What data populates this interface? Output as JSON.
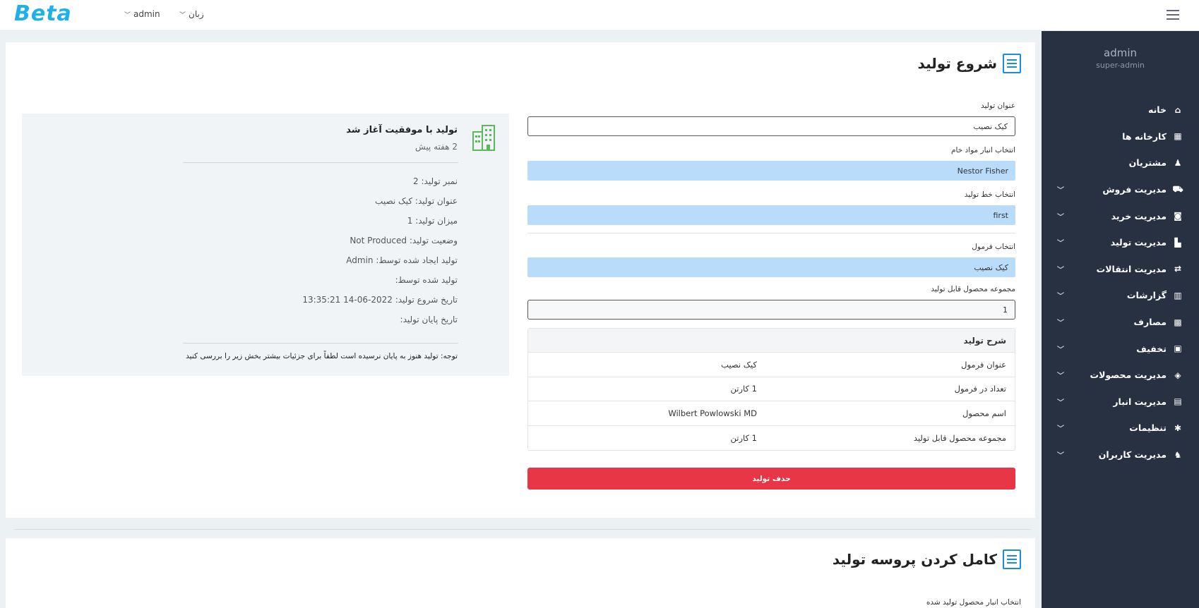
{
  "topbar": {
    "logo": "Beta",
    "user_menu": "admin",
    "language_menu": "زبان"
  },
  "sidebar": {
    "user_name": "admin",
    "user_role": "super-admin",
    "items": [
      {
        "label": "خانه",
        "icon": "home-icon",
        "glyph": "⌂",
        "submenu": false
      },
      {
        "label": "کارخانه ها",
        "icon": "factory-icon",
        "glyph": "▦",
        "submenu": false
      },
      {
        "label": "مشتریان",
        "icon": "users-icon",
        "glyph": "♟",
        "submenu": false
      },
      {
        "label": "مدیریت فروش",
        "icon": "cart-icon",
        "glyph": "⛟",
        "submenu": true
      },
      {
        "label": "مدیریت خرید",
        "icon": "bag-icon",
        "glyph": "◙",
        "submenu": true
      },
      {
        "label": "مدیریت تولید",
        "icon": "production-icon",
        "glyph": "▙",
        "submenu": true
      },
      {
        "label": "مدیریت انتقالات",
        "icon": "transfer-icon",
        "glyph": "⇄",
        "submenu": true
      },
      {
        "label": "گزارشات",
        "icon": "report-icon",
        "glyph": "▥",
        "submenu": true
      },
      {
        "label": "مصارف",
        "icon": "expense-icon",
        "glyph": "▩",
        "submenu": true
      },
      {
        "label": "تخفیف",
        "icon": "gift-icon",
        "glyph": "▣",
        "submenu": true
      },
      {
        "label": "مدیریت محصولات",
        "icon": "product-icon",
        "glyph": "◈",
        "submenu": true
      },
      {
        "label": "مدیریت انبار",
        "icon": "warehouse-icon",
        "glyph": "▤",
        "submenu": true
      },
      {
        "label": "تنظیمات",
        "icon": "gear-icon",
        "glyph": "✱",
        "submenu": true
      },
      {
        "label": "مدیریت کاربران",
        "icon": "user-group-icon",
        "glyph": "♞",
        "submenu": true
      }
    ]
  },
  "start_card": {
    "title": "شروع تولید",
    "fields": {
      "title_label": "عنوان تولید",
      "title_value": "کیک نصیب",
      "raw_warehouse_label": "انتخاب انبار مواد خام",
      "raw_warehouse_value": "Nestor Fisher",
      "line_label": "انتخاب خط تولید",
      "line_value": "first",
      "formula_label": "انتخاب فرمول",
      "formula_value": "کیک نصیب",
      "total_label": "مجموعه محصول قابل تولید",
      "total_value": "1"
    },
    "table": {
      "heading": "شرح تولید",
      "rows": [
        {
          "key": "عنوان فرمول",
          "value": "کیک نصیب"
        },
        {
          "key": "تعداد در فرمول",
          "value": "1 کارتن"
        },
        {
          "key": "اسم محصول",
          "value": "Wilbert Powlowski MD"
        },
        {
          "key": "مجموعه محصول قابل تولید",
          "value": "1 کارتن"
        }
      ]
    },
    "delete_button": "حذف تولید"
  },
  "status_panel": {
    "title": "تولید با موفقیت آغاز شد",
    "time_ago": "2 هفته پیش",
    "lines": [
      "نمبر تولید: 2",
      "عنوان تولید: کیک نصیب",
      "میزان تولید: 1",
      "وضعیت تولید: Not Produced",
      "تولید ایجاد شده توسط: Admin",
      "تولید شده توسط:",
      "تاریخ شروع تولید: 2022-06-14 13:35:21",
      "تاریخ پایان تولید:"
    ],
    "note": "توجه: تولید هنوز به پایان نرسیده است لطفاً برای جزئیات بیشتر بخش زیر را بررسی کنید"
  },
  "complete_card": {
    "title": "کامل کردن پروسه تولید",
    "warehouse_label": "انتخاب انبار محصول تولید شده"
  },
  "colors": {
    "brand": "#1eb0e8",
    "sidebar_bg": "#273142",
    "select_bg": "#b9dcfb",
    "danger": "#e83646",
    "icon_accent": "#1a8fd8",
    "success_icon": "#5cb85c"
  }
}
